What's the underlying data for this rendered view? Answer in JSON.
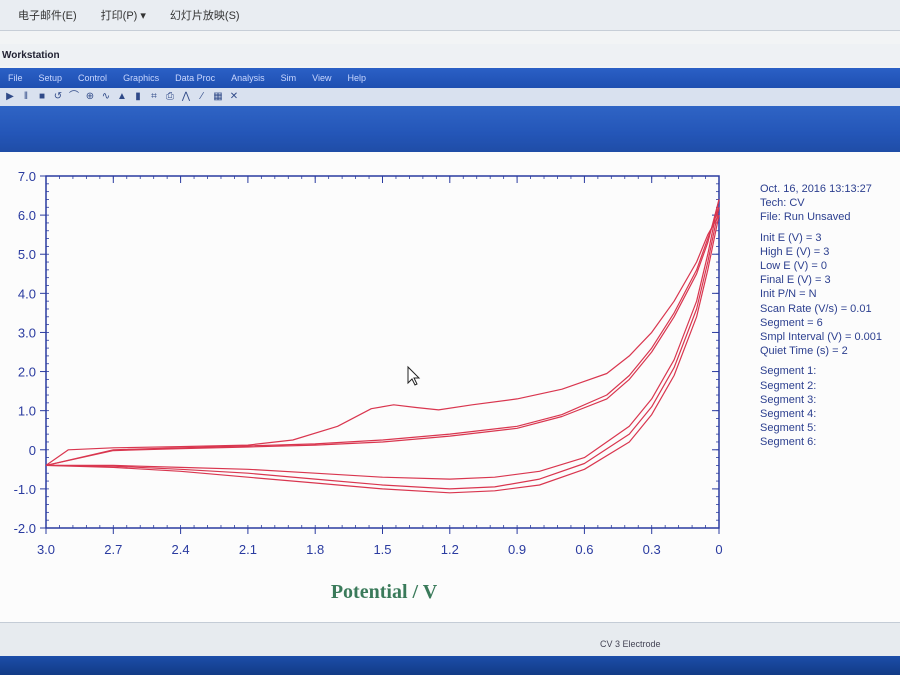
{
  "menubar": {
    "items": [
      "电子邮件(E)",
      "打印(P) ▾",
      "幻灯片放映(S)"
    ]
  },
  "window": {
    "title": "Workstation"
  },
  "appmenu": {
    "items": [
      "File",
      "Setup",
      "Control",
      "Graphics",
      "Data Proc",
      "Analysis",
      "Sim",
      "View",
      "Help"
    ]
  },
  "toolbar": {
    "icons": [
      "run-icon",
      "pause-icon",
      "stop-icon",
      "reverse-icon",
      "ir-comp-icon",
      "zoom-icon",
      "smooth-icon",
      "filter-icon",
      "color-bars-icon",
      "plot-icon",
      "print-icon",
      "peak-icon",
      "overlay-icon",
      "graph-options-icon",
      "close-icon"
    ]
  },
  "info": {
    "date": "Oct. 16, 2016   13:13:27",
    "tech": "Tech: CV",
    "file": "File: Run Unsaved",
    "params": [
      "Init E (V) = 3",
      "High E (V) = 3",
      "Low E (V) = 0",
      "Final E (V) = 3",
      "Init P/N = N",
      "Scan Rate (V/s) = 0.01",
      "Segment = 6",
      "Smpl Interval (V) = 0.001",
      "Quiet Time (s) = 2"
    ],
    "segments": [
      "Segment 1:",
      "Segment 2:",
      "Segment 3:",
      "Segment 4:",
      "Segment 5:",
      "Segment 6:"
    ]
  },
  "status": {
    "text": "CV    3 Electrode"
  },
  "colors": {
    "curve": "#d9364f",
    "axis": "#2a3ba0",
    "info_text": "#2c3f8f",
    "xlabel": "#3a7a5a"
  },
  "chart_data": {
    "type": "line",
    "title": "",
    "xlabel": "Potential / V",
    "ylabel": "",
    "xlim": [
      3.0,
      0
    ],
    "ylim": [
      -2.0,
      7.0
    ],
    "x_ticks": [
      "3.0",
      "2.7",
      "2.4",
      "2.1",
      "1.8",
      "1.5",
      "1.2",
      "0.9",
      "0.6",
      "0.3",
      "0"
    ],
    "y_ticks": [
      "7.0",
      "6.0",
      "5.0",
      "4.0",
      "3.0",
      "2.0",
      "1.0",
      "0",
      "-1.0",
      "-2.0"
    ],
    "grid": false,
    "series": [
      {
        "x": [
          3.0,
          2.9,
          2.7,
          2.4,
          2.1,
          1.9,
          1.7,
          1.55,
          1.45,
          1.35,
          1.25,
          1.1,
          0.9,
          0.7,
          0.5,
          0.4,
          0.3,
          0.2,
          0.1,
          0.05,
          0.0
        ],
        "y": [
          -0.4,
          0.0,
          0.05,
          0.08,
          0.12,
          0.25,
          0.6,
          1.05,
          1.15,
          1.08,
          1.02,
          1.15,
          1.3,
          1.55,
          1.95,
          2.4,
          3.0,
          3.8,
          4.8,
          5.5,
          6.0
        ]
      },
      {
        "x": [
          0.0,
          0.05,
          0.1,
          0.2,
          0.3,
          0.4,
          0.6,
          0.8,
          1.0,
          1.2,
          1.5,
          1.8,
          2.1,
          2.4,
          2.7,
          3.0
        ],
        "y": [
          6.0,
          4.6,
          3.4,
          1.9,
          0.9,
          0.2,
          -0.5,
          -0.9,
          -1.05,
          -1.1,
          -1.0,
          -0.85,
          -0.7,
          -0.55,
          -0.45,
          -0.4
        ]
      },
      {
        "x": [
          3.0,
          2.7,
          2.4,
          2.1,
          1.8,
          1.5,
          1.2,
          0.9,
          0.7,
          0.5,
          0.4,
          0.3,
          0.2,
          0.1,
          0.05,
          0.0
        ],
        "y": [
          -0.4,
          0.0,
          0.05,
          0.1,
          0.15,
          0.25,
          0.4,
          0.6,
          0.9,
          1.4,
          1.9,
          2.6,
          3.5,
          4.6,
          5.4,
          6.2
        ]
      },
      {
        "x": [
          0.0,
          0.05,
          0.1,
          0.2,
          0.3,
          0.4,
          0.6,
          0.8,
          1.0,
          1.2,
          1.5,
          1.8,
          2.1,
          2.4,
          2.7,
          3.0
        ],
        "y": [
          6.2,
          4.8,
          3.6,
          2.1,
          1.1,
          0.4,
          -0.35,
          -0.75,
          -0.95,
          -1.0,
          -0.9,
          -0.75,
          -0.6,
          -0.5,
          -0.42,
          -0.4
        ]
      },
      {
        "x": [
          3.0,
          2.7,
          2.4,
          2.1,
          1.8,
          1.5,
          1.2,
          0.9,
          0.7,
          0.5,
          0.4,
          0.3,
          0.2,
          0.1,
          0.05,
          0.0
        ],
        "y": [
          -0.4,
          -0.02,
          0.03,
          0.07,
          0.12,
          0.2,
          0.35,
          0.55,
          0.85,
          1.3,
          1.8,
          2.5,
          3.4,
          4.5,
          5.3,
          6.4
        ]
      },
      {
        "x": [
          0.0,
          0.05,
          0.1,
          0.2,
          0.3,
          0.4,
          0.6,
          0.8,
          1.0,
          1.2,
          1.5,
          1.8,
          2.1,
          2.4,
          2.7,
          3.0
        ],
        "y": [
          6.4,
          5.0,
          3.8,
          2.3,
          1.3,
          0.6,
          -0.2,
          -0.55,
          -0.7,
          -0.75,
          -0.7,
          -0.6,
          -0.5,
          -0.45,
          -0.4,
          -0.4
        ]
      }
    ]
  }
}
